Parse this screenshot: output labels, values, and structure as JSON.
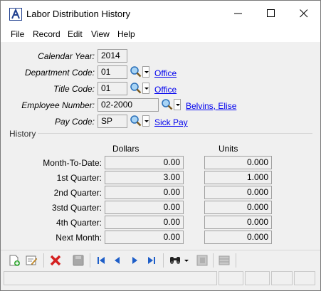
{
  "window": {
    "title": "Labor Distribution History"
  },
  "menu": [
    "File",
    "Record",
    "Edit",
    "View",
    "Help"
  ],
  "form": {
    "calendar_year": {
      "label": "Calendar Year:",
      "value": "2014"
    },
    "department_code": {
      "label": "Department Code:",
      "value": "01",
      "link": "Office"
    },
    "title_code": {
      "label": "Title Code:",
      "value": "01",
      "link": "Office"
    },
    "employee_number": {
      "label": "Employee Number:",
      "value": "02-2000",
      "link": "Belvins, Elise"
    },
    "pay_code": {
      "label": "Pay Code:",
      "value": "SP",
      "link": "Sick Pay"
    }
  },
  "history": {
    "section_label": "History",
    "col_dollars": "Dollars",
    "col_units": "Units",
    "rows": [
      {
        "label": "Month-To-Date:",
        "dollars": "0.00",
        "units": "0.000"
      },
      {
        "label": "1st Quarter:",
        "dollars": "3.00",
        "units": "1.000"
      },
      {
        "label": "2nd Quarter:",
        "dollars": "0.00",
        "units": "0.000"
      },
      {
        "label": "3std Quarter:",
        "dollars": "0.00",
        "units": "0.000"
      },
      {
        "label": "4th Quarter:",
        "dollars": "0.00",
        "units": "0.000"
      },
      {
        "label": "Next Month:",
        "dollars": "0.00",
        "units": "0.000"
      }
    ]
  },
  "toolbar": {
    "icons": [
      "new-record-icon",
      "edit-record-icon",
      "delete-icon",
      "save-icon",
      "first-record-icon",
      "previous-record-icon",
      "next-record-icon",
      "last-record-icon",
      "find-binoculars-icon",
      "find-dropdown-icon",
      "browse-icon",
      "list-icon"
    ]
  },
  "colors": {
    "link": "#0000ee",
    "delete": "#d42020",
    "nav_arrow": "#1e5ec8"
  }
}
